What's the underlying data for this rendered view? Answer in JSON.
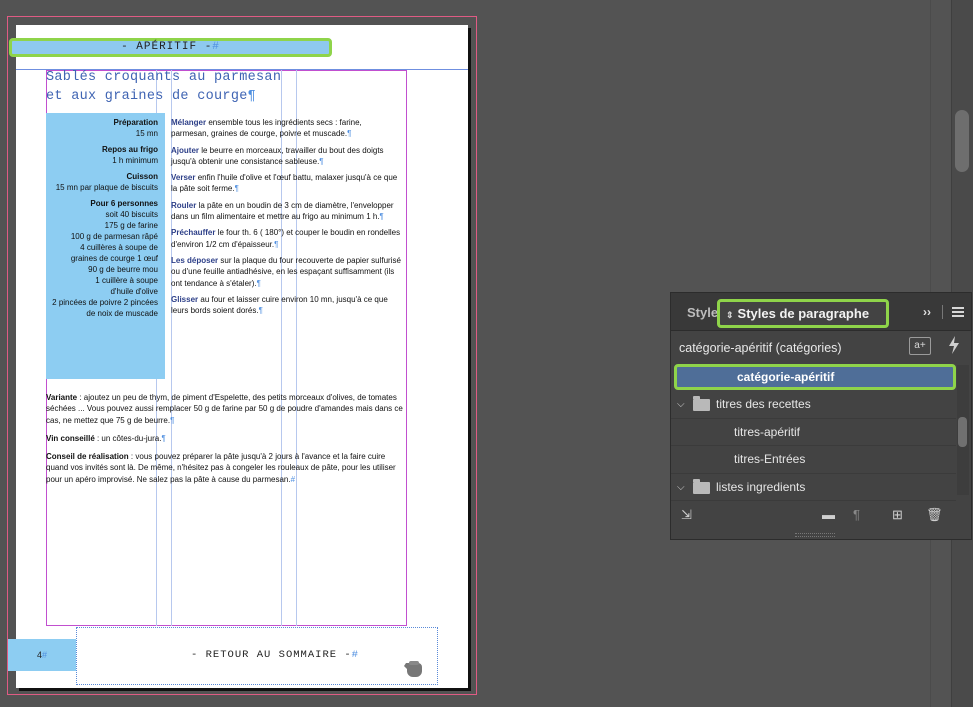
{
  "document": {
    "header": "- APÉRITIF -",
    "title_line1": "Sablés croquants au parmesan",
    "title_line2": "et aux graines de courge",
    "info": [
      {
        "label": "Préparation",
        "lines": [
          "15 mn"
        ]
      },
      {
        "label": "Repos au frigo",
        "lines": [
          "1 h minimum"
        ]
      },
      {
        "label": "Cuisson",
        "lines": [
          "15 mn par plaque de biscuits"
        ]
      },
      {
        "label": "Pour 6 personnes",
        "lines": [
          "soit 40 biscuits",
          "175 g de farine",
          "100 g de parmesan râpé",
          "4 cuillères à soupe de",
          "graines de courge 1 œuf",
          "90 g de beurre mou",
          "1 cuillère à soupe",
          "d'huile d'olive",
          "2 pincées de poivre 2 pincées",
          "de noix de muscade"
        ]
      }
    ],
    "steps": [
      {
        "verb": "Mélanger",
        "text": " ensemble tous les ingrédients secs : farine, parmesan, graines de courge, poivre et muscade."
      },
      {
        "verb": "Ajouter",
        "text": " le beurre en morceaux, travailler du bout des doigts jusqu'à obtenir une consistance sableuse."
      },
      {
        "verb": "Verser",
        "text": " enfin l'huile d'olive et l'œuf battu, malaxer jusqu'à ce que la pâte soit ferme."
      },
      {
        "verb": "Rouler",
        "text": " la pâte en un boudin de 3 cm de diamètre, l'envelopper dans un film alimentaire et mettre au frigo au minimum 1 h."
      },
      {
        "verb": "Préchauffer",
        "text": " le four th. 6 ( 180°) et couper le boudin en rondelles d'environ 1/2 cm d'épaisseur."
      },
      {
        "verb": "Les déposer",
        "text": " sur la plaque du four recouverte de papier sulfurisé ou d'une feuille antiadhésive, en les espaçant suffisamment (ils ont tendance à s'étaler)."
      },
      {
        "verb": "Glisser",
        "text": " au four et laisser cuire environ 10 mn, jusqu'à ce que leurs bords soient dorés."
      }
    ],
    "variante_label": "Variante",
    "variante_text": " : ajoutez un peu de thym, de piment d'Espelette, des petits morceaux d'olives, de tomates séchées ... Vous pouvez aussi remplacer 50 g de farine par 50 g de poudre d'amandes mais dans ce cas, ne mettez que 75 g de beurre.",
    "vin_label": "Vin conseillé",
    "vin_text": " : un côtes-du-jura.",
    "conseil_label": "Conseil de réalisation",
    "conseil_text": " : vous pouvez préparer la pâte jusqu'à 2 jours à l'avance et la faire cuire quand vos invités sont là. De même, n'hésitez pas à congeler les rouleaux de pâte, pour les utiliser pour un apéro improvisé. Ne salez pas la pâte à cause du parmesan.",
    "page_number": "4",
    "footer": "- RETOUR AU SOMMAIRE -",
    "pilcrow": "¶",
    "hash": "#"
  },
  "panel": {
    "tab_inactive": "Style",
    "tab_active": "Styles de paragraphe",
    "expand": "››",
    "current_style": "catégorie-apéritif (catégories)",
    "new_style_icon": "a+",
    "items": [
      {
        "label": "catégorie-apéritif",
        "type": "style",
        "selected": true
      },
      {
        "label": "titres des recettes",
        "type": "group"
      },
      {
        "label": "titres-apéritif",
        "type": "style"
      },
      {
        "label": "titres-Entrées",
        "type": "style"
      },
      {
        "label": "listes ingredients",
        "type": "group"
      }
    ]
  },
  "colors": {
    "selection_outline": "#8fd44a",
    "selected_row": "#4f6e98",
    "sidebar_fill": "#8dcdf2",
    "title_color": "#3f64b3",
    "verb_color": "#2d3f88"
  }
}
